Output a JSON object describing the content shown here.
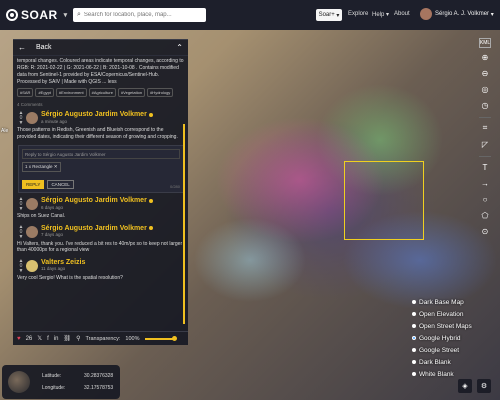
{
  "header": {
    "logo": "SOAR",
    "search_placeholder": "Search for location, place, map...",
    "soar_plus": "Soar+",
    "nav": {
      "explore": "Explore",
      "help": "Help",
      "about": "About"
    },
    "user_name": "Sérgio A. J. Volkmer"
  },
  "panel": {
    "back_label": "Back",
    "description": "temporal changes. Coloured areas indicate temporal changes, according to RGB: R: 2021-02-22 | G: 2021-06-22 | B: 2021-10-08 . Contains modified data from Sentinel-1 provided by ESA/Copernicus/Sentinel-Hub. Processed by SAIV | Made with QGIS ... less",
    "tags": [
      "#SAR",
      "#Egypt",
      "#Environment",
      "#Agriculture",
      "#Vegetation",
      "#Hydrology"
    ],
    "comment_count": "4 Comments",
    "comments": [
      {
        "votes": "0",
        "author": "Sérgio Augusto Jardim Volkmer",
        "time": "a minute ago",
        "text": "Those patterns in Redish, Greenish and Blueish correspond to the provided dates, indicating their different season of growing and cropping."
      },
      {
        "votes": "0",
        "author": "Sérgio Augusto Jardim Volkmer",
        "time": "6 days ago",
        "text": "Ships on Suez Canal."
      },
      {
        "votes": "0",
        "author": "Sérgio Augusto Jardim Volkmer",
        "time": "7 days ago",
        "text": "Hi Valters, thank you. I've reduced a bit res to 40m/px so to keep not larger than 40000px for a regional view"
      },
      {
        "votes": "0",
        "author": "Valters Zeizis",
        "time": "11 days ago",
        "text": "Very cool Sergio! What is the spatial resolution?"
      }
    ],
    "reply": {
      "placeholder": "Reply to Sérgio Augusto Jardim Volkmer",
      "chip": "1 x Rectangle ✕",
      "reply_btn": "REPLY",
      "cancel_btn": "CANCEL",
      "char_count": "0/280"
    },
    "likes": "26",
    "transparency_label": "Transparency:",
    "transparency_value": "100%",
    "transparency_level": 1.0
  },
  "coords": {
    "lat_label": "Latitude:",
    "lat": "30.28376328",
    "lon_label": "Longitude:",
    "lon": "32.17578753"
  },
  "layers": {
    "selected": "Google Hybrid",
    "items": [
      "Dark Base Map",
      "Open Elevation",
      "Open Street Maps",
      "Google Hybrid",
      "Google Street",
      "Dark Blank",
      "White Blank"
    ]
  },
  "map_labels": {
    "left_city": "Ale"
  }
}
